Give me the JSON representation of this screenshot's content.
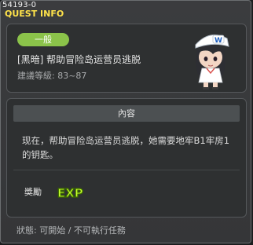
{
  "window": {
    "quest_id": "54193-0",
    "header": "QUEST INFO"
  },
  "quest": {
    "category_badge": "一般",
    "title": "[黑暗] 帮助冒险岛运营员逃脱",
    "level_requirement": "建議等級: 83~87"
  },
  "content": {
    "section_title": "內容",
    "description": "现在，帮助冒险岛运营员逃脱，她需要地牢B1牢房1的钥匙。"
  },
  "reward": {
    "label": "獎勵",
    "icon": "exp-icon",
    "icon_text": "EXP"
  },
  "status": {
    "text": "狀態: 可開始 / 不可執行任務"
  },
  "colors": {
    "header": "#ffe34a",
    "badge": "#8bc34a",
    "exp_fill": "#c7ff2e"
  }
}
